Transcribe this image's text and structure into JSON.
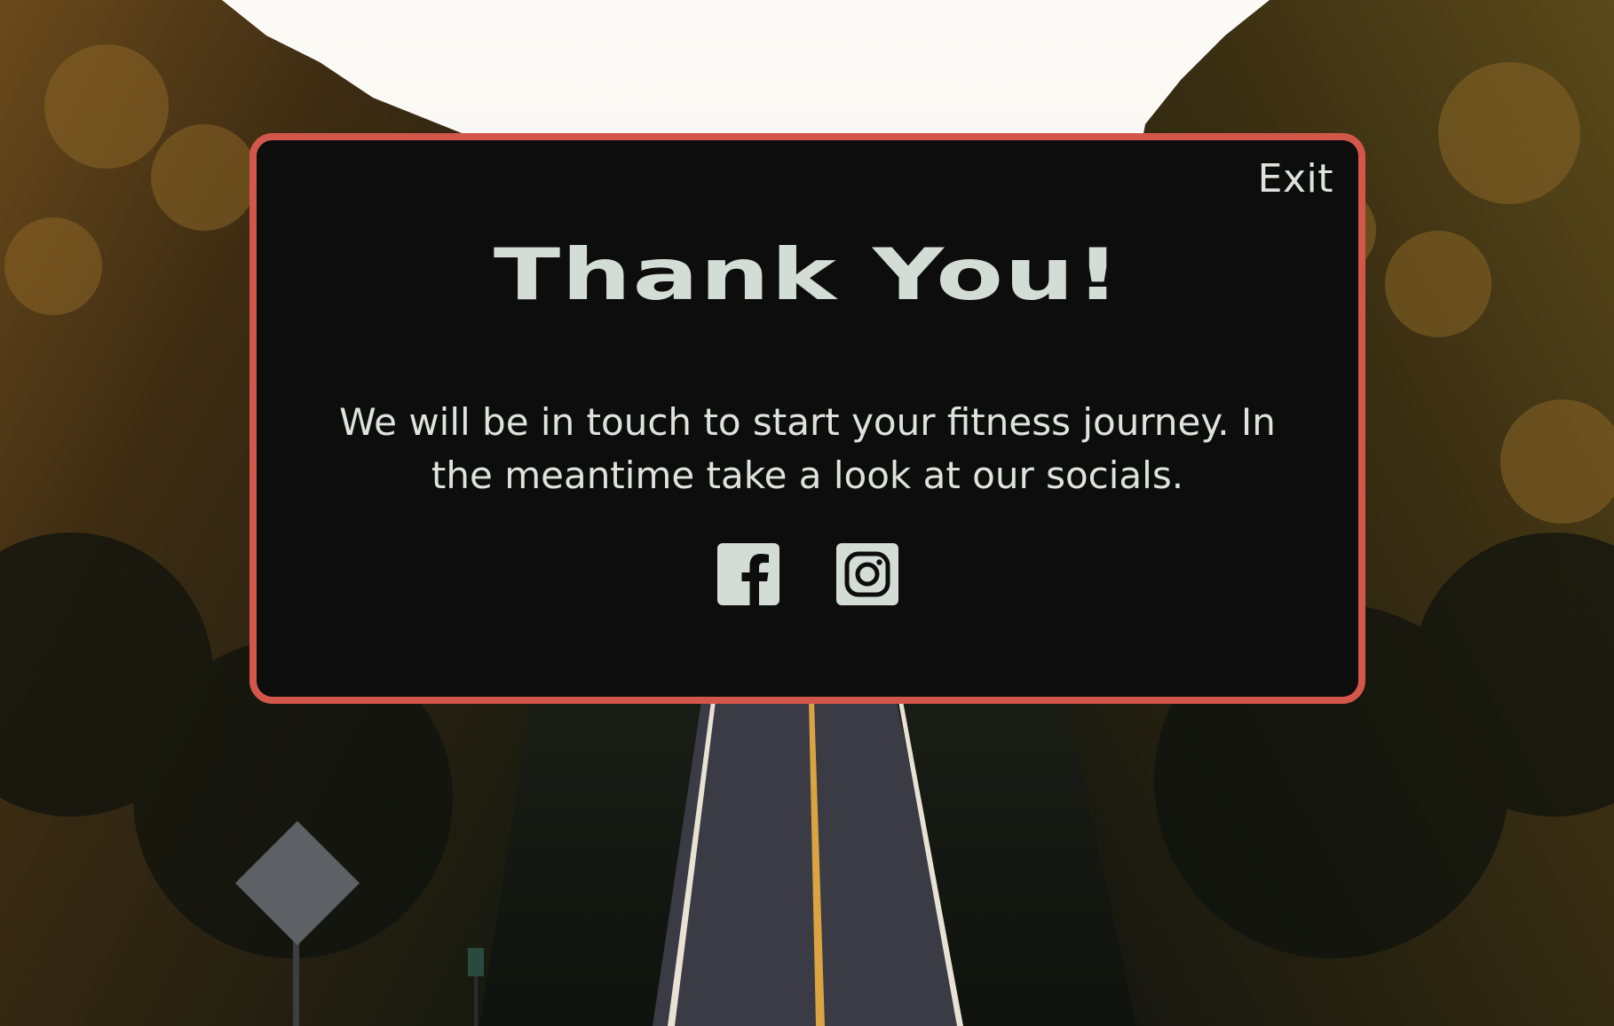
{
  "modal": {
    "exit_label": "Exit",
    "title": "Thank You!",
    "message": "We will be in touch to start your fitness journey. In the meantime take a look at our socials."
  },
  "socials": [
    {
      "name": "facebook",
      "icon": "facebook-icon"
    },
    {
      "name": "instagram",
      "icon": "instagram-icon"
    }
  ],
  "colors": {
    "modal_border": "#d2574a",
    "modal_background": "#0d0d0d",
    "text": "#dfe3df",
    "icon": "#d4dcd6"
  }
}
